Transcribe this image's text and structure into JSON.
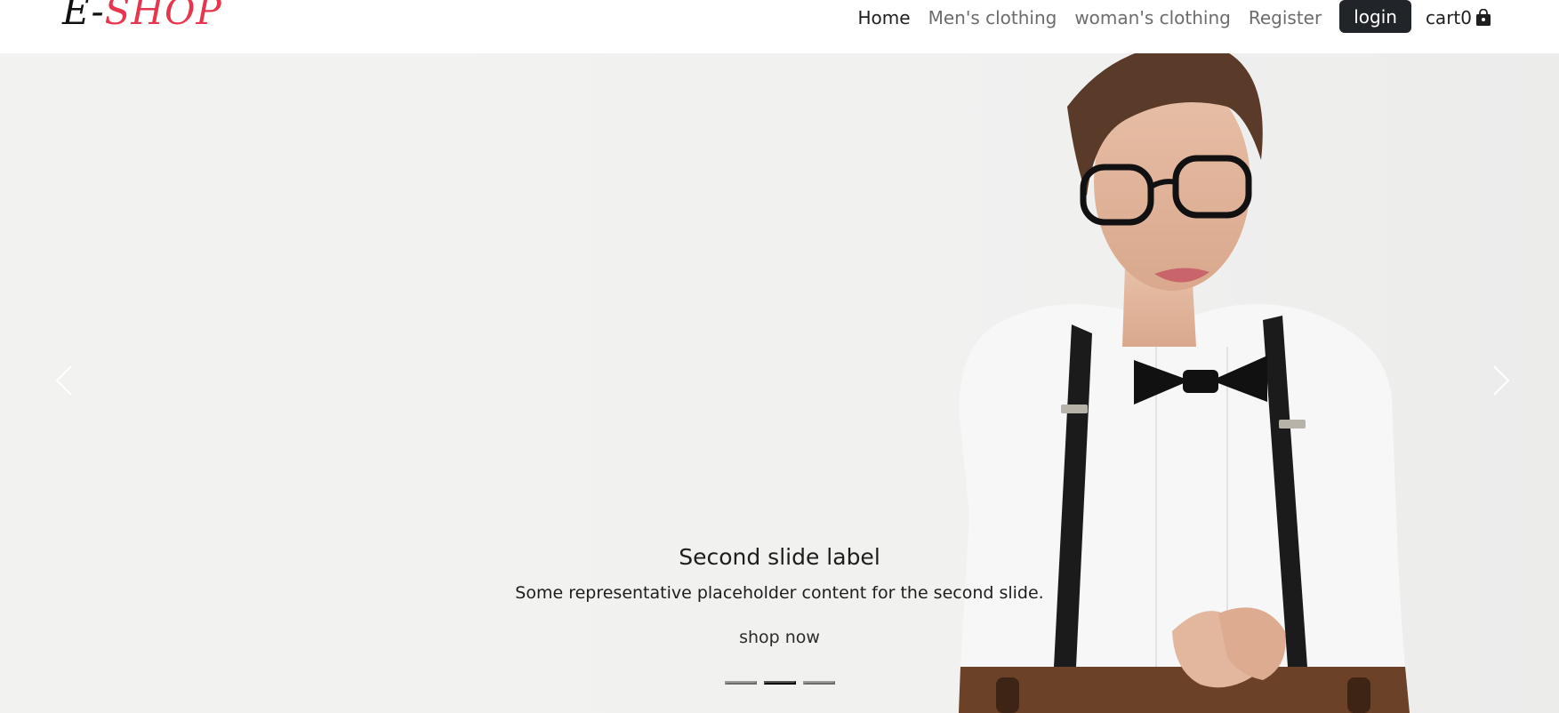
{
  "brand": {
    "part_e": "E-",
    "part_shop": "SHOP"
  },
  "nav": {
    "items": [
      {
        "label": "Home",
        "active": true
      },
      {
        "label": "Men's clothing",
        "active": false
      },
      {
        "label": "woman's clothing",
        "active": false
      },
      {
        "label": "Register",
        "active": false
      }
    ],
    "login_label": "login",
    "cart_label": "cart",
    "cart_count": "0",
    "cart_icon": "shopping-bag-icon"
  },
  "carousel": {
    "caption_title": "Second slide label",
    "caption_text": "Some representative placeholder content for the second slide.",
    "cta_label": "shop now",
    "active_slide": 2,
    "slide_count": 3,
    "prev_icon": "chevron-left-icon",
    "next_icon": "chevron-right-icon"
  },
  "colors": {
    "brand_accent": "#e8354e",
    "login_bg": "#212529",
    "hero_bg": "#f1f1f0"
  }
}
